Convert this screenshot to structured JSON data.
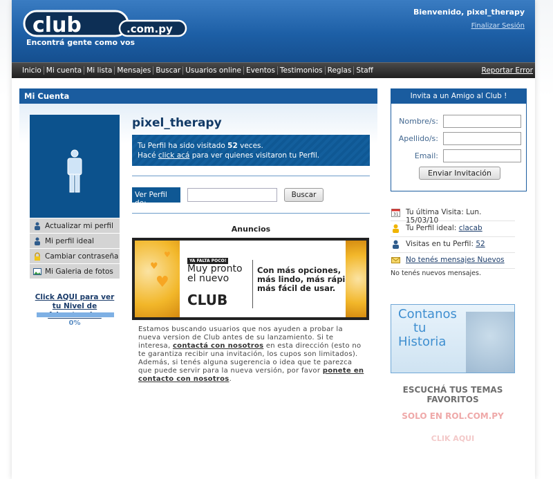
{
  "header": {
    "tagline": "Encontrá gente como vos",
    "welcome": "Bienvenido, pixel_therapy",
    "logout": "Finalizar Sesión"
  },
  "nav": {
    "items": [
      "Inicio",
      "Mi cuenta",
      "Mi lista",
      "Mensajes",
      "Buscar",
      "Usuarios online",
      "Eventos",
      "Testimonios",
      "Reglas",
      "Staff"
    ],
    "report": "Reportar Error"
  },
  "main": {
    "title": "Mi Cuenta",
    "username": "pixel_therapy",
    "visits_line1_pre": "Tu Perfil ha sido visitado ",
    "visits_count": "52",
    "visits_line1_post": " veces.",
    "visits_line2_pre": "Hacé ",
    "visits_link": "click acá",
    "visits_line2_post": " para ver quienes visitaron tu Perfil.",
    "view_profile_label": "Ver Perfil de:",
    "search_button": "Buscar",
    "ads_title": "Anuncios",
    "side_menu": [
      "Actualizar mi perfil",
      "Mi perfil ideal",
      "Cambiar contraseña",
      "Mi Galeria de fotos"
    ],
    "warnings_link": "Click AQUI para ver tu Nivel de Advertencias",
    "warnings_level": "0%",
    "banner": {
      "tag": "YA FALTA POCO!",
      "headline_1": "Muy pronto",
      "headline_2": "el nuevo",
      "brand": "CLUB",
      "right_1": "Con más opciones,",
      "right_2": "más lindo, más rápido,",
      "right_3": "más fácil de usar."
    },
    "promo_1": "Estamos buscando usuarios que nos ayuden a probar la nueva version de Club antes de su lanzamiento. Si te interesa, ",
    "promo_link_1": "contactá con nosotros",
    "promo_2": " en esta dirección (esto no te garantiza recibir una invitación, los cupos son limitados). Además, si tenés alguna sugerencia o idea que te parezca que puede servir para la nueva versión, por favor ",
    "promo_link_2": "ponete en contacto con nosotros",
    "promo_3": "."
  },
  "invite": {
    "title": "Invita a un Amigo al Club !",
    "name_label": "Nombre/s:",
    "surname_label": "Apellido/s:",
    "email_label": "Email:",
    "send_button": "Enviar Invitación"
  },
  "status": {
    "last_visit_label": "Tu última Visita: ",
    "last_visit_value": "Lun. 15/03/10",
    "ideal_label": "Tu Perfil ideal: ",
    "ideal_value": "clacab",
    "profile_visits_label": "Visitas en tu Perfil: ",
    "profile_visits_value": "52",
    "messages_link": "No tenés mensajes Nuevos",
    "messages_sub": "No tenés nuevos mensajes."
  },
  "rol_ad": {
    "title_1": "Contanos",
    "title_2": "tu",
    "title_3": "Historia",
    "line_1": "ESCUCHÁ TUS TEMAS FAVORITOS",
    "line_2": "SOLO EN ROL.COM.PY",
    "line_3": "CLIK AQUI"
  },
  "colors": {
    "header_blue": "#1d5fa6",
    "panel_blue": "#1a5c9f",
    "nav_dark": "#2a2a2a"
  }
}
